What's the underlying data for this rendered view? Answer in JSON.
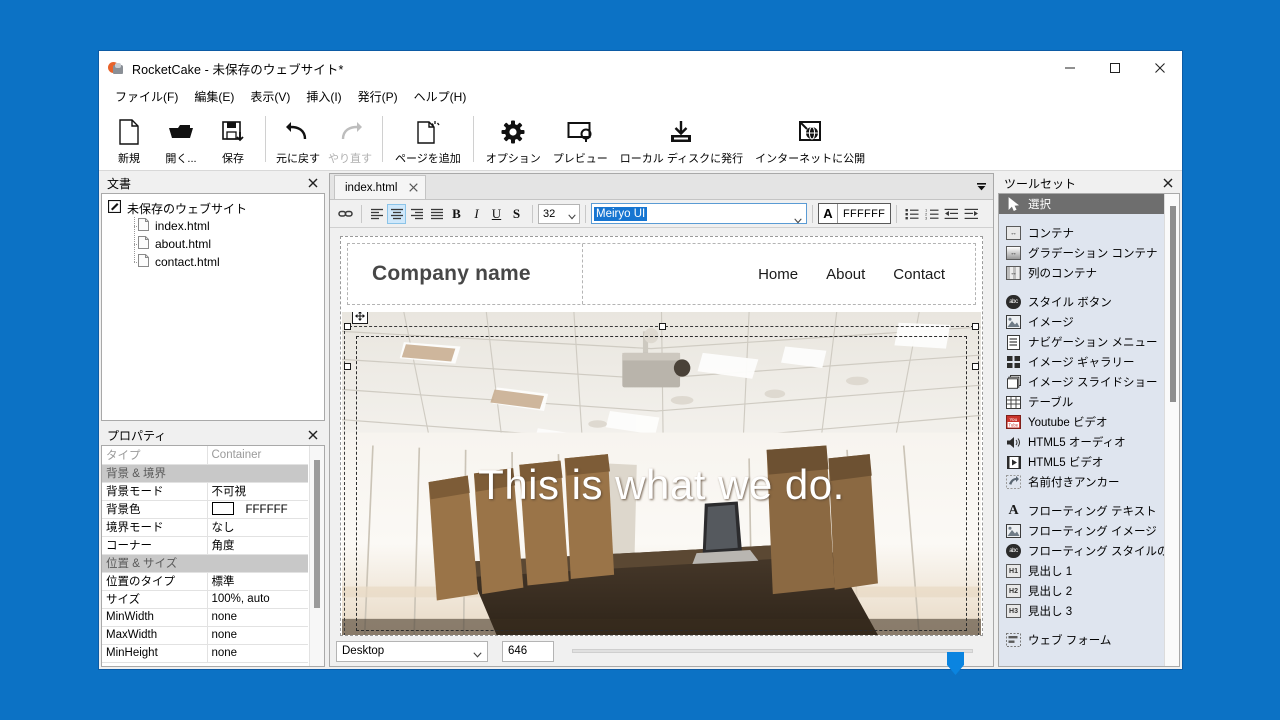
{
  "window": {
    "title": "RocketCake - 未保存のウェブサイト*",
    "minimize_label": "最小化",
    "maximize_label": "最大化",
    "close_label": "閉じる"
  },
  "menubar": {
    "items": [
      {
        "label": "ファイル(F)"
      },
      {
        "label": "編集(E)"
      },
      {
        "label": "表示(V)"
      },
      {
        "label": "挿入(I)"
      },
      {
        "label": "発行(P)"
      },
      {
        "label": "ヘルプ(H)"
      }
    ]
  },
  "toolbar": {
    "buttons": [
      {
        "label": "新規",
        "icon": "new-page-icon",
        "disabled": false
      },
      {
        "label": "開く...",
        "icon": "open-folder-icon",
        "disabled": false
      },
      {
        "label": "保存",
        "icon": "save-disk-icon",
        "disabled": false
      },
      {
        "label": "元に戻す",
        "icon": "undo-arrow-icon",
        "disabled": false
      },
      {
        "label": "やり直す",
        "icon": "redo-arrow-icon",
        "disabled": true
      },
      {
        "label": "ページを追加",
        "icon": "add-page-icon",
        "disabled": false
      },
      {
        "label": "オプション",
        "icon": "gear-icon",
        "disabled": false
      },
      {
        "label": "プレビュー",
        "icon": "preview-screen-icon",
        "disabled": false
      },
      {
        "label": "ローカル ディスクに発行",
        "icon": "publish-disk-icon",
        "disabled": false
      },
      {
        "label": "インターネットに公開",
        "icon": "publish-internet-icon",
        "disabled": false
      }
    ]
  },
  "document_panel": {
    "title": "文書",
    "root": {
      "label": "未保存のウェブサイト",
      "icon": "website-edit-icon"
    },
    "files": [
      {
        "label": "index.html",
        "icon": "file-icon"
      },
      {
        "label": "about.html",
        "icon": "file-icon"
      },
      {
        "label": "contact.html",
        "icon": "file-icon"
      }
    ]
  },
  "properties_panel": {
    "title": "プロパティ",
    "rows": [
      {
        "key": "タイプ",
        "value": "Container",
        "kind": "readonly"
      },
      {
        "key": "背景 & 境界",
        "value": "",
        "kind": "section"
      },
      {
        "key": "背景モード",
        "value": "不可視",
        "kind": "normal"
      },
      {
        "key": "背景色",
        "value": "FFFFFF",
        "kind": "color"
      },
      {
        "key": "境界モード",
        "value": "なし",
        "kind": "normal"
      },
      {
        "key": "コーナー",
        "value": "角度",
        "kind": "normal"
      },
      {
        "key": "位置 & サイズ",
        "value": "",
        "kind": "section"
      },
      {
        "key": "位置のタイプ",
        "value": "標準",
        "kind": "normal"
      },
      {
        "key": "サイズ",
        "value": "100%, auto",
        "kind": "normal"
      },
      {
        "key": "MinWidth",
        "value": "none",
        "kind": "normal"
      },
      {
        "key": "MaxWidth",
        "value": "none",
        "kind": "normal"
      },
      {
        "key": "MinHeight",
        "value": "none",
        "kind": "normal"
      }
    ]
  },
  "editor": {
    "tab": {
      "label": "index.html",
      "close_label": "×"
    },
    "overflow_label": "▼",
    "format_bar": {
      "link_icon": "link-icon",
      "align_left_icon": "align-left-icon",
      "align_center_icon": "align-center-icon",
      "align_right_icon": "align-right-icon",
      "align_justify_icon": "align-justify-icon",
      "bold_label": "B",
      "italic_label": "I",
      "underline_label": "U",
      "strike_label": "S",
      "font_size": "32",
      "font_family": "Meiryo UI",
      "text_color_glyph": "A",
      "text_color_hex": "FFFFFF",
      "bullet_list_icon": "bullet-list-icon",
      "numbered_list_icon": "numbered-list-icon",
      "outdent_icon": "outdent-icon",
      "indent_icon": "indent-icon"
    },
    "status": {
      "device": "Desktop",
      "width_value": "646"
    }
  },
  "page_preview": {
    "brand": "Company name",
    "nav": [
      {
        "label": "Home"
      },
      {
        "label": "About"
      },
      {
        "label": "Contact"
      }
    ],
    "headline": "This is what we do.",
    "photo_alt": "office-ceiling-conference-room-photo"
  },
  "toolset_panel": {
    "title": "ツールセット",
    "groups": [
      {
        "items": [
          {
            "label": "選択",
            "icon": "cursor-arrow-icon",
            "selected": true
          }
        ]
      },
      {
        "items": [
          {
            "label": "コンテナ",
            "icon": "container-icon",
            "selected": false
          },
          {
            "label": "グラデーション コンテナ",
            "icon": "gradient-container-icon",
            "selected": false
          },
          {
            "label": "列のコンテナ",
            "icon": "column-container-icon",
            "selected": false
          }
        ]
      },
      {
        "items": [
          {
            "label": "スタイル ボタン",
            "icon": "style-button-icon",
            "selected": false
          },
          {
            "label": "イメージ",
            "icon": "image-icon",
            "selected": false
          },
          {
            "label": "ナビゲーション メニュー",
            "icon": "nav-menu-icon",
            "selected": false
          },
          {
            "label": "イメージ ギャラリー",
            "icon": "image-gallery-icon",
            "selected": false
          },
          {
            "label": "イメージ スライドショー",
            "icon": "image-slideshow-icon",
            "selected": false
          },
          {
            "label": "テーブル",
            "icon": "table-icon",
            "selected": false
          },
          {
            "label": "Youtube ビデオ",
            "icon": "youtube-icon",
            "selected": false
          },
          {
            "label": "HTML5 オーディオ",
            "icon": "audio-icon",
            "selected": false
          },
          {
            "label": "HTML5 ビデオ",
            "icon": "video-icon",
            "selected": false
          },
          {
            "label": "名前付きアンカー",
            "icon": "anchor-icon",
            "selected": false
          }
        ]
      },
      {
        "items": [
          {
            "label": "フローティング テキスト",
            "icon": "floating-text-icon",
            "selected": false
          },
          {
            "label": "フローティング イメージ",
            "icon": "floating-image-icon",
            "selected": false
          },
          {
            "label": "フローティング スタイルのボタン",
            "icon": "floating-style-button-icon",
            "selected": false
          },
          {
            "label": "見出し 1",
            "icon": "heading1-icon",
            "selected": false
          },
          {
            "label": "見出し 2",
            "icon": "heading2-icon",
            "selected": false
          },
          {
            "label": "見出し 3",
            "icon": "heading3-icon",
            "selected": false
          }
        ]
      },
      {
        "items": [
          {
            "label": "ウェブ フォーム",
            "icon": "web-form-icon",
            "selected": false
          }
        ]
      }
    ]
  },
  "colors": {
    "desktop_background": "#0c72c5",
    "accent_selection": "#1675d1",
    "toolset_background": "#dfe5ef",
    "selected_row": "#6e6e6e",
    "section_row": "#c8c8c8"
  }
}
